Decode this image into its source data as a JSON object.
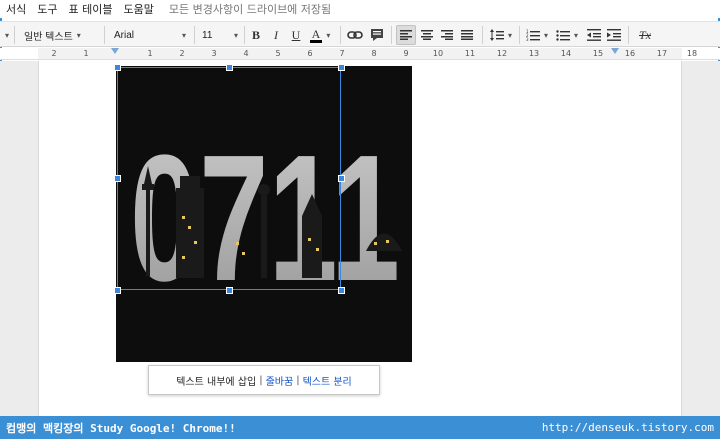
{
  "menu": {
    "items": [
      "서식",
      "도구",
      "표",
      "테이블",
      "도움말"
    ],
    "save_status": "모든 변경사항이 드라이브에 저장됨"
  },
  "toolbar": {
    "style_label": "일반 텍스트",
    "font_label": "Arial",
    "size_label": "11",
    "bold_label": "B",
    "italic_label": "I",
    "underline_label": "U",
    "text_color_label": "A",
    "clear_format_label": "Tx"
  },
  "ruler": {
    "numbers": [
      "2",
      "1",
      "1",
      "2",
      "3",
      "4",
      "5",
      "6",
      "7",
      "8",
      "9",
      "10",
      "11",
      "12",
      "13",
      "14",
      "15",
      "16",
      "17",
      "18"
    ]
  },
  "image": {
    "content_text": "0711",
    "icon": "city-skyline-image"
  },
  "image_popup": {
    "inline_label": "텍스트 내부에 삽입",
    "wrap_label": "줄바꿈",
    "break_label": "텍스트 분리",
    "separator": "|"
  },
  "footer": {
    "left_text": "컴맹의 맥킹장의 Study Google! Chrome!!",
    "right_text": "http://denseuk.tistory.com"
  },
  "colors": {
    "accent": "#3b8fd5",
    "selection": "#3d86dd",
    "link": "#1155cc"
  }
}
